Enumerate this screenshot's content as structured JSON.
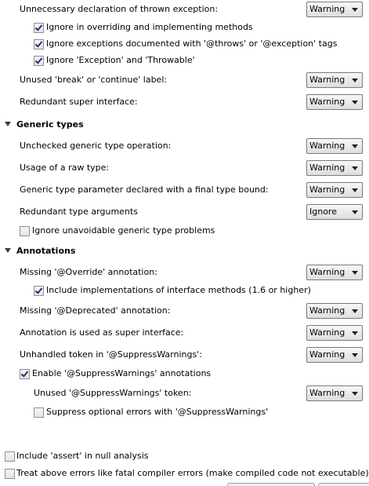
{
  "severity_options_visible": {
    "warning": "Warning",
    "ignore": "Ignore"
  },
  "unnecessary_declaration": {
    "label": "Unnecessary declaration of thrown exception:",
    "severity": "Warning",
    "sub_options": [
      {
        "label": "Ignore in overriding and implementing methods",
        "checked": true
      },
      {
        "label": "Ignore exceptions documented with '@throws' or '@exception' tags",
        "checked": true
      },
      {
        "label": "Ignore 'Exception' and 'Throwable'",
        "checked": true
      }
    ]
  },
  "unused_break": {
    "label": "Unused 'break' or 'continue' label:",
    "severity": "Warning"
  },
  "redundant_super_interface": {
    "label": "Redundant super interface:",
    "severity": "Warning"
  },
  "generic_types": {
    "title": "Generic types",
    "items": [
      {
        "label": "Unchecked generic type operation:",
        "severity": "Warning"
      },
      {
        "label": "Usage of a raw type:",
        "severity": "Warning"
      },
      {
        "label": "Generic type parameter declared with a final type bound:",
        "severity": "Warning"
      },
      {
        "label": "Redundant type arguments",
        "severity": "Ignore"
      }
    ],
    "ignore_unavoidable": {
      "label": "Ignore unavoidable generic type problems",
      "checked": false
    }
  },
  "annotations": {
    "title": "Annotations",
    "missing_override": {
      "label": "Missing '@Override' annotation:",
      "severity": "Warning"
    },
    "include_interface": {
      "label": "Include implementations of interface methods (1.6 or higher)",
      "checked": true
    },
    "missing_deprecated": {
      "label": "Missing '@Deprecated' annotation:",
      "severity": "Warning"
    },
    "super_interface": {
      "label": "Annotation is used as super interface:",
      "severity": "Warning"
    },
    "unhandled_token": {
      "label": "Unhandled token in '@SuppressWarnings':",
      "severity": "Warning"
    },
    "enable_suppress": {
      "label": "Enable '@SuppressWarnings' annotations",
      "checked": true
    },
    "unused_suppress": {
      "label": "Unused '@SuppressWarnings' token:",
      "severity": "Warning"
    },
    "suppress_optional": {
      "label": "Suppress optional errors with '@SuppressWarnings'",
      "checked": false
    }
  },
  "global": {
    "include_assert": {
      "label": "Include 'assert' in null analysis",
      "checked": false
    },
    "treat_fatal": {
      "label": "Treat above errors like fatal compiler errors (make compiled code not executable)",
      "checked": false
    }
  }
}
